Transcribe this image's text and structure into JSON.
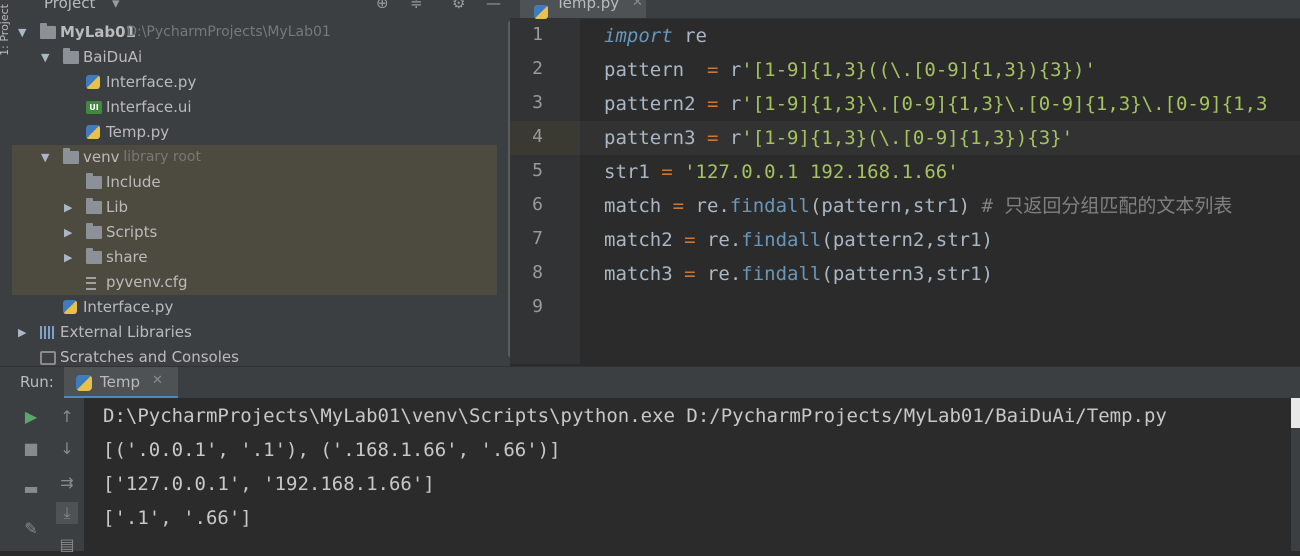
{
  "left_strip": {
    "label": "1: Project"
  },
  "project_panel": {
    "title": "Project",
    "tree": [
      {
        "label": "MyLab01",
        "path": "D:\\PycharmProjects\\MyLab01",
        "type": "folder",
        "level": 0,
        "expanded": true
      },
      {
        "label": "BaiDuAi",
        "type": "folder",
        "level": 1,
        "expanded": true
      },
      {
        "label": "Interface.py",
        "type": "python",
        "level": 2
      },
      {
        "label": "Interface.ui",
        "type": "ui",
        "level": 2
      },
      {
        "label": "Temp.py",
        "type": "python",
        "level": 2
      },
      {
        "label": "venv",
        "suffix": "library root",
        "type": "folder",
        "level": 1,
        "expanded": true
      },
      {
        "label": "Include",
        "type": "folder",
        "level": 2
      },
      {
        "label": "Lib",
        "type": "folder",
        "level": 2,
        "collapsed": true
      },
      {
        "label": "Scripts",
        "type": "folder",
        "level": 2,
        "collapsed": true
      },
      {
        "label": "share",
        "type": "folder",
        "level": 2,
        "collapsed": true
      },
      {
        "label": "pyvenv.cfg",
        "type": "cfg",
        "level": 2
      },
      {
        "label": "Interface.py",
        "type": "python",
        "level": 1
      },
      {
        "label": "External Libraries",
        "type": "library",
        "level": 0,
        "collapsed": true
      },
      {
        "label": "Scratches and Consoles",
        "type": "scratch",
        "level": 0
      }
    ]
  },
  "editor": {
    "tab_label": "Temp.py",
    "line_numbers": [
      "1",
      "2",
      "3",
      "4",
      "5",
      "6",
      "7",
      "8",
      "9"
    ],
    "current_line": 4,
    "code_lines": [
      "import re",
      "pattern  = r'[1-9]{1,3}((\\.[0-9]{1,3}){3})'",
      "pattern2 = r'[1-9]{1,3}\\.[0-9]{1,3}\\.[0-9]{1,3}\\.[0-9]{1,3",
      "pattern3 = r'[1-9]{1,3}(\\.[0-9]{1,3}){3}'",
      "str1 = '127.0.0.1 192.168.1.66'",
      "match = re.findall(pattern,str1) # 只返回分组匹配的文本列表",
      "match2 = re.findall(pattern2,str1)",
      "match3 = re.findall(pattern3,str1)",
      ""
    ]
  },
  "run_panel": {
    "label": "Run:",
    "tab_label": "Temp",
    "output": [
      "D:\\PycharmProjects\\MyLab01\\venv\\Scripts\\python.exe D:/PycharmProjects/MyLab01/BaiDuAi/Temp.py",
      "[('.0.0.1', '.1'), ('.168.1.66', '.66')]",
      "['127.0.0.1', '192.168.1.66']",
      "['.1', '.66']"
    ]
  },
  "colors": {
    "panel_bg": "#3c3f41",
    "editor_bg": "#2b2b2b",
    "keyword": "#cc7832",
    "string": "#6a8759",
    "function": "#6897bb",
    "comment": "#808080",
    "highlight_row": "#4d4a3f"
  }
}
